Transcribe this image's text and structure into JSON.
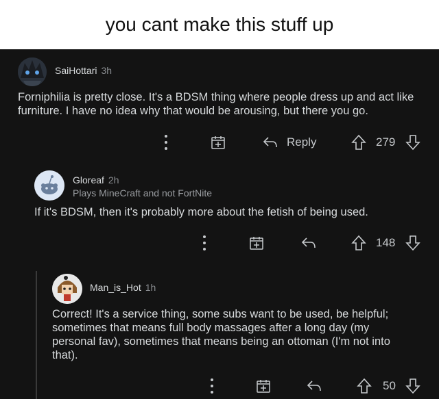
{
  "caption": {
    "text": "you cant make this stuff up"
  },
  "comments": [
    {
      "username": "SaiHottari",
      "time": "3h",
      "body": "Forniphilia is pretty close. It's a BDSM thing where people dress up and act like furniture. I have no idea why that would be arousing, but there you go.",
      "reply_label": "Reply",
      "score": "279",
      "avatar_icon": "anime-avatar-icon"
    },
    {
      "username": "Gloreaf",
      "time": "2h",
      "flair": "Plays MineCraft and not FortNite",
      "body": "If it's BDSM, then it's probably more about the fetish of being used.",
      "score": "148",
      "avatar_icon": "snoo-avatar-icon"
    },
    {
      "username": "Man_is_Hot",
      "time": "1h",
      "body": "Correct! It's a service thing, some subs want to be used, be helpful; sometimes that means full body massages after a long day (my personal fav), sometimes that means being an ottoman (I'm not into that).",
      "score": "50",
      "avatar_icon": "cartoon-avatar-icon"
    }
  ],
  "colors": {
    "background": "#131313",
    "text": "#d7dadc",
    "muted": "#8a8d91"
  }
}
